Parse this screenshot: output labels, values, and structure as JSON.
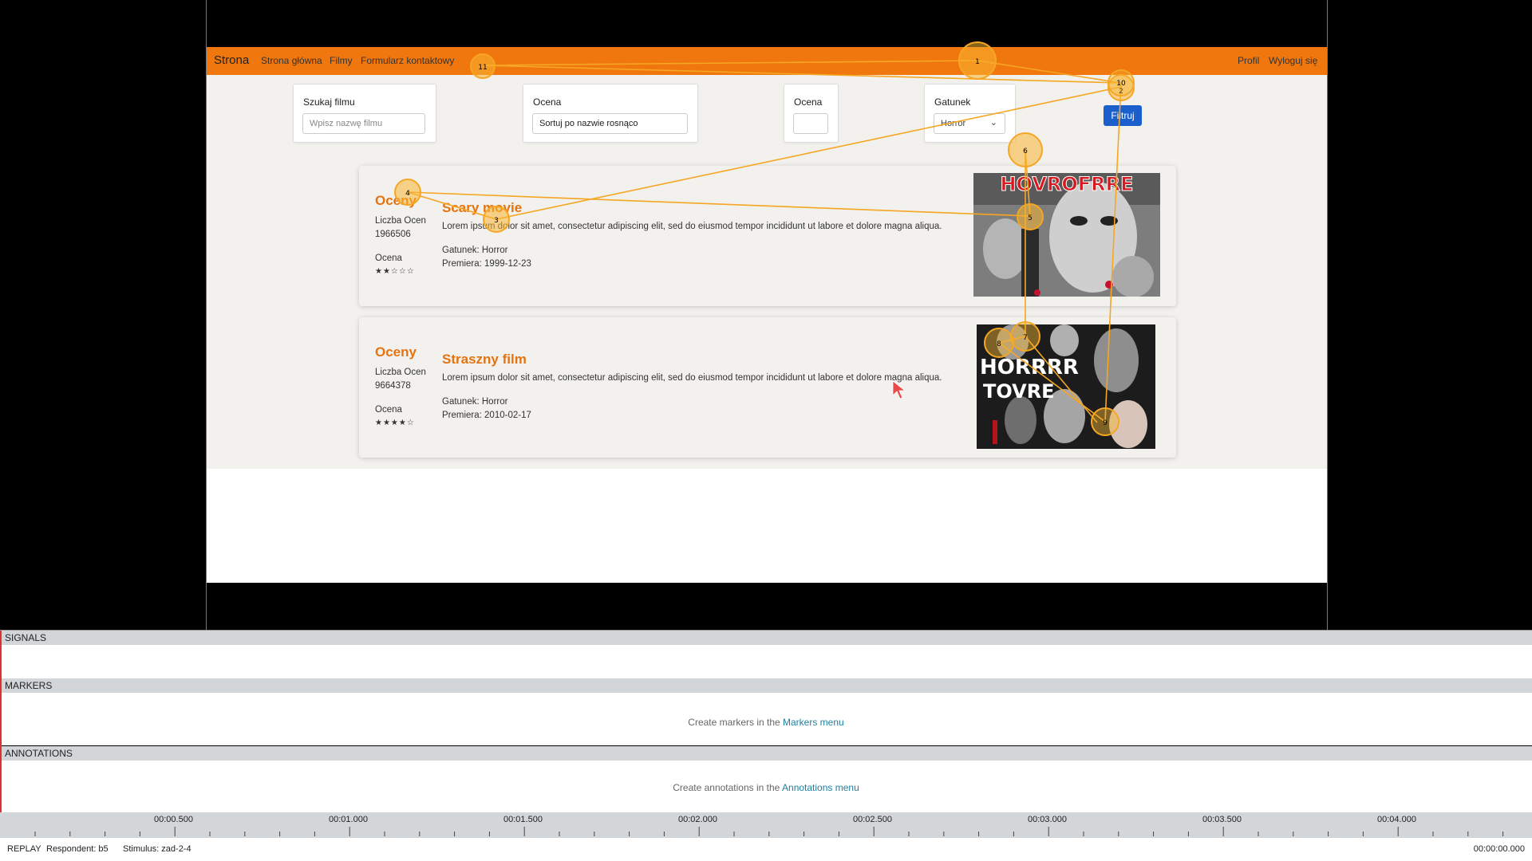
{
  "navbar": {
    "brand": "Strona",
    "links": [
      "Strona główna",
      "Filmy",
      "Formularz kontaktowy"
    ],
    "right_links": [
      "Profil",
      "Wyloguj się"
    ],
    "color": "#f0770e"
  },
  "filters": {
    "search_label": "Szukaj filmu",
    "search_placeholder": "Wpisz nazwę filmu",
    "sort_label": "Ocena",
    "sort_value": "Sortuj po nazwie rosnąco",
    "rating_label": "Ocena",
    "rating_value": "",
    "genre_label": "Gatunek",
    "genre_value": "Horror",
    "filter_button": "Filtruj"
  },
  "movies": [
    {
      "ratings_title": "Oceny",
      "count_label": "Liczba Ocen",
      "count_value": "1966506",
      "rating_label": "Ocena",
      "stars": "★★☆☆☆",
      "title": "Scary movie",
      "description": "Lorem ipsum dolor sit amet, consectetur adipiscing elit, sed do eiusmod tempor incididunt ut labore et dolore magna aliqua.",
      "genre": "Gatunek: Horror",
      "premiere": "Premiera: 1999-12-23",
      "poster_text": "HOVROFRRE"
    },
    {
      "ratings_title": "Oceny",
      "count_label": "Liczba Ocen",
      "count_value": "9664378",
      "rating_label": "Ocena",
      "stars": "★★★★☆",
      "title": "Straszny film",
      "description": "Lorem ipsum dolor sit amet, consectetur adipiscing elit, sed do eiusmod tempor incididunt ut labore et dolore magna aliqua.",
      "genre": "Gatunek: Horror",
      "premiere": "Premiera: 2010-02-17",
      "poster_text_line1": "HORRRR",
      "poster_text_line2": "TOVRE"
    }
  ],
  "gaze_points": [
    "1",
    "2",
    "3",
    "4",
    "5",
    "6",
    "7",
    "8",
    "9",
    "10",
    "11"
  ],
  "gaze_color": "#f5a623",
  "panels": {
    "signals": "SIGNALS",
    "markers": "MARKERS",
    "markers_hint": "Create markers in the ",
    "markers_link": "Markers menu",
    "annotations": "ANNOTATIONS",
    "annotations_hint": "Create annotations in the ",
    "annotations_link": "Annotations menu"
  },
  "timeline": {
    "labels": [
      "00:00.500",
      "00:01.000",
      "00:01.500",
      "00:02.000",
      "00:02.500",
      "00:03.000",
      "00:03.500",
      "00:04.000"
    ]
  },
  "status": {
    "mode": "REPLAY",
    "respondent": "Respondent: b5",
    "stimulus": "Stimulus: zad-2-4",
    "time": "00:00:00.000"
  }
}
